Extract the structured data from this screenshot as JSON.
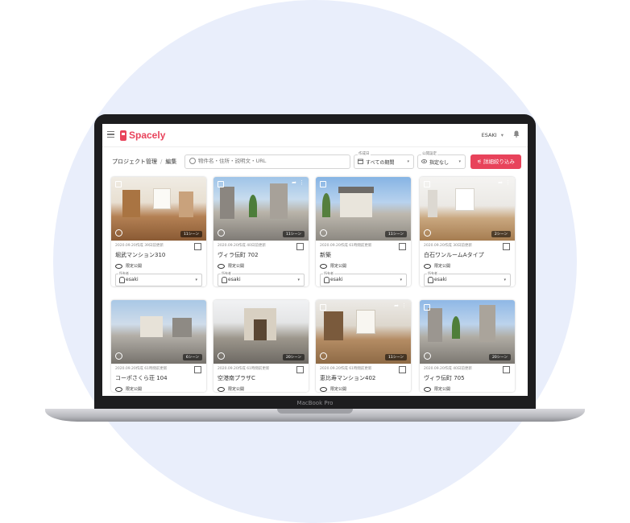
{
  "header": {
    "brand": "Spacely",
    "user": "ESAKI",
    "user_chevron": "▾"
  },
  "toolbar": {
    "breadcrumb_root": "プロジェクト管理",
    "breadcrumb_sep": "/",
    "breadcrumb_current": "編集",
    "search_placeholder": "物件名・住所・説明文・URL",
    "period_caption": "作成日",
    "period_value": "すべての期間",
    "public_caption": "公開設定",
    "public_value": "指定なし",
    "filter_button": "詳細絞り込み",
    "chevron": "▾"
  },
  "card_labels": {
    "owner_caption": "所有者",
    "visibility": "限定公開",
    "chevron": "▾"
  },
  "cards": [
    {
      "scenes": "11シーン",
      "date": "2020.09.20作成 39日前更新",
      "title": "堀武マンション310",
      "owner": "esaki"
    },
    {
      "scenes": "11シーン",
      "date": "2020.09.20作成 40日前更新",
      "title": "ヴィラ伝町 702",
      "owner": "esaki"
    },
    {
      "scenes": "11シーン",
      "date": "2020.09.20作成 61時間前更新",
      "title": "新築",
      "owner": "esaki"
    },
    {
      "scenes": "2シーン",
      "date": "2020.09.20作成 30日前更新",
      "title": "白石ワンルームAタイプ",
      "owner": "esaki"
    },
    {
      "scenes": "6シーン",
      "date": "2020.09.20作成 61時間前更新",
      "title": "コーポさくら荘 104",
      "owner": ""
    },
    {
      "scenes": "20シーン",
      "date": "2020.09.20作成 61時間前更新",
      "title": "空港南プラザC",
      "owner": ""
    },
    {
      "scenes": "11シーン",
      "date": "2020.09.20作成 61時間前更新",
      "title": "恵比寿マンション402",
      "owner": ""
    },
    {
      "scenes": "20シーン",
      "date": "2020.09.20作成 40日前更新",
      "title": "ヴィラ伝町 705",
      "owner": ""
    }
  ],
  "device_label": "MacBook Pro",
  "colors": {
    "accent": "#e8435b",
    "background_circle": "#e9eefb",
    "bezel": "#1d1d1f"
  },
  "icons": [
    "menu-icon",
    "bell-icon",
    "search-icon",
    "calendar-icon",
    "eye-icon",
    "filter-icon",
    "checkbox-icon",
    "share-icon",
    "more-icon",
    "play-icon",
    "qr-icon",
    "person-icon"
  ]
}
